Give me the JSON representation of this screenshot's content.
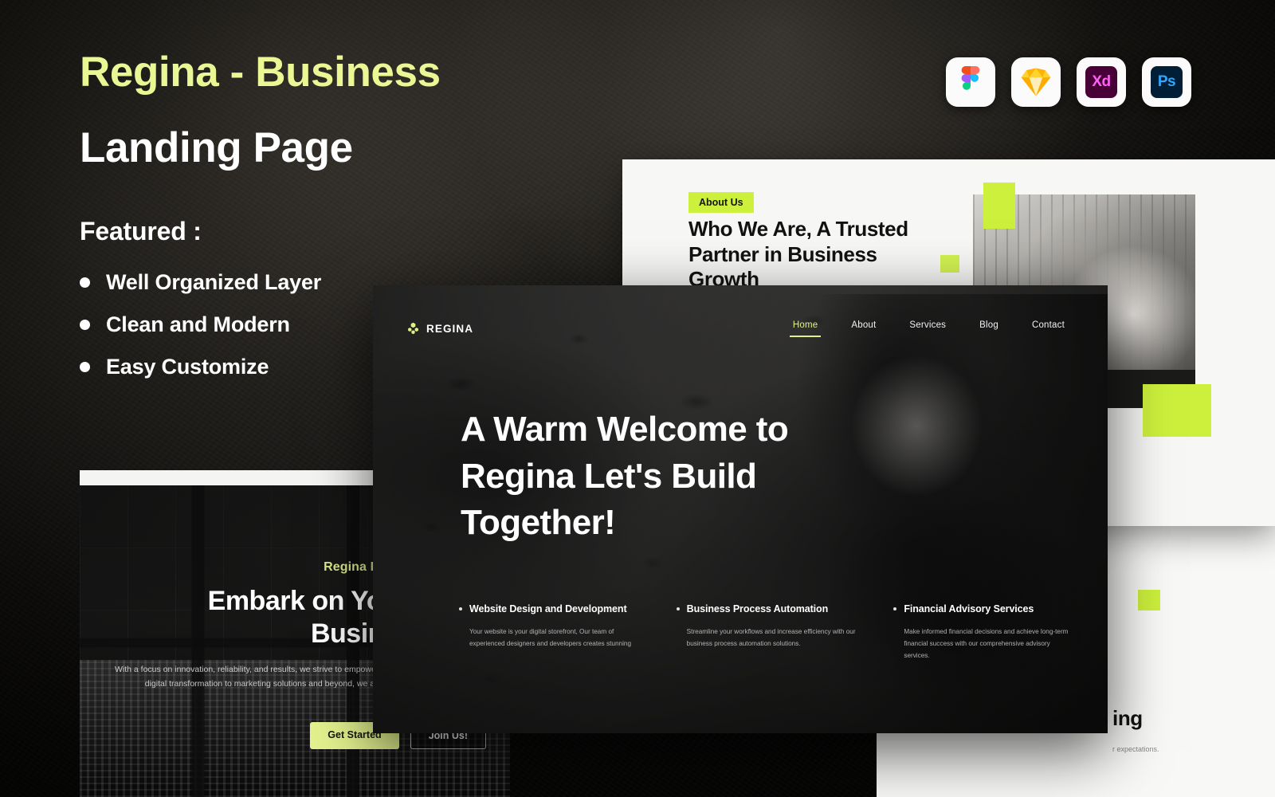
{
  "promo": {
    "title_accent": "Regina - Business",
    "title_main": "Landing Page",
    "featured_label": "Featured :",
    "features": [
      "Well Organized Layer",
      "Clean and Modern",
      "Easy Customize"
    ]
  },
  "app_badges": [
    {
      "name": "figma-icon",
      "label": "Figma"
    },
    {
      "name": "sketch-icon",
      "label": "Sketch"
    },
    {
      "name": "adobe-xd-icon",
      "label": "Xd"
    },
    {
      "name": "photoshop-icon",
      "label": "Ps"
    }
  ],
  "hero_mockup": {
    "logo_text": "REGINA",
    "nav": [
      {
        "label": "Home",
        "active": true
      },
      {
        "label": "About",
        "active": false
      },
      {
        "label": "Services",
        "active": false
      },
      {
        "label": "Blog",
        "active": false
      },
      {
        "label": "Contact",
        "active": false
      }
    ],
    "heading_lines": [
      "A Warm Welcome to",
      "Regina Let's Build",
      "Together!"
    ],
    "columns": [
      {
        "title": "Website Design and Development",
        "body": "Your website is your digital storefront, Our team of experienced designers and developers creates stunning"
      },
      {
        "title": "Business Process Automation",
        "body": "Streamline your workflows and increase efficiency with our business process automation solutions."
      },
      {
        "title": "Financial Advisory Services",
        "body": "Make informed financial decisions and achieve long-term financial success with our comprehensive advisory services."
      }
    ]
  },
  "about_mockup": {
    "tag": "About Us",
    "heading": "Who We Are, A Trusted Partner in Business Growth"
  },
  "bottom_left_mockup": {
    "eyebrow": "Regina Business Landing",
    "heading_line1": "Embark on Your Busin",
    "heading_line2": "Business Join",
    "body_line1": "With a focus on innovation, reliability, and results, we strive to empower our clients to achieve their goals",
    "body_line2": "digital transformation to marketing solutions and beyond, we are committed to deliver",
    "primary_button": "Get Started",
    "secondary_button": "Join Us!"
  },
  "bottom_right_mockup": {
    "heading_fragment": "ing",
    "body_fragment": "r expectations."
  },
  "colors": {
    "accent_pale": "#e9f795",
    "accent_lime": "#ccf03c",
    "background": "#0d0c0b",
    "panel_light": "#f7f7f5"
  }
}
